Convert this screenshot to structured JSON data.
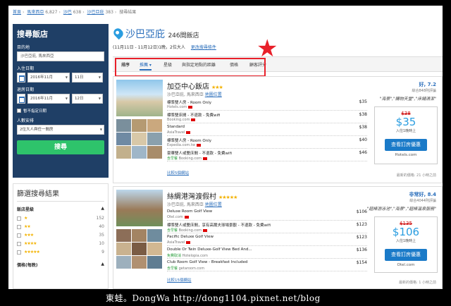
{
  "breadcrumb": {
    "items": [
      "首頁",
      "馬來西亞",
      "沙巴",
      "沙巴亞庇",
      "搜尋結果"
    ],
    "counts": [
      "6,827",
      "638",
      "383"
    ]
  },
  "search": {
    "title": "搜尋飯店",
    "dest_label": "目的地",
    "dest_value": "沙巴亞庇, 馬來西亞",
    "checkin_label": "入住日期",
    "checkin_month": "2016年11月",
    "checkin_day": "11日",
    "checkout_label": "退房日期",
    "checkout_month": "2016年11月",
    "checkout_day": "12日",
    "nodate_label": "暫不指定日期",
    "guests_label": "人數安排",
    "guests_value": "2位大人與任一間房",
    "submit": "搜尋"
  },
  "filter": {
    "title": "篩選搜尋結果",
    "section": "飯店星級",
    "rows": [
      {
        "stars": "★",
        "count": "152"
      },
      {
        "stars": "★★",
        "count": "40"
      },
      {
        "stars": "★★★",
        "count": "35"
      },
      {
        "stars": "★★★★",
        "count": "10"
      },
      {
        "stars": "★★★★★",
        "count": "9"
      }
    ],
    "price_section": "價格(每晚)"
  },
  "header": {
    "city": "沙巴亞庇",
    "count": "246間飯店",
    "dates": "(11月11日 - 11月12日)1晚，2位大人",
    "change_link": "更改搜尋條件"
  },
  "tabs": [
    "排序",
    "推薦",
    "星級",
    "與指定地點的距離",
    "價格",
    "顧客評分"
  ],
  "hotels": [
    {
      "name": "加亞中心飯店",
      "stars": "★★★",
      "location": "沙巴亞庇, 馬來西亞",
      "map_link": "地圖位置",
      "rating": "好, 7.2",
      "reviews": "綜合848則評論",
      "quote": "\"海景\",\"購物天堂\",\"床鋪清潔\"",
      "offers": [
        {
          "name": "標準雙人房 - Room Only",
          "site": "Hotels.com",
          "price": "$35"
        },
        {
          "name": "標準雙床間 - 不退款 - 免費wifi",
          "site": "Booking.com",
          "price": "$38"
        },
        {
          "name": "Standard",
          "site": "AsiaTravel",
          "price": "$38"
        },
        {
          "name": "標準雙人房 - Room Only",
          "site": "Expedia.com.tw",
          "price": "$40"
        },
        {
          "name": "豪華雙人或雙床間 - 不退款 - 免費wifi",
          "site": "Booking.com",
          "price": "$46",
          "deal": "含早餐"
        }
      ],
      "more": "比較5個網站",
      "old_price": "$38",
      "price": "$35",
      "min": "入住1晚時上",
      "deal_btn": "查看訂房優惠",
      "deal_site": "Hotels.com",
      "updated": "最新的價格: 21 小時之前"
    },
    {
      "name": "絲綢港灣渡假村",
      "stars": "★★★★★",
      "location": "沙巴亞庇, 馬來西亞",
      "map_link": "地圖位置",
      "rating": "非常好, 8.4",
      "reviews": "綜合4044則評論",
      "quote": "\"超棒游泳池\",\"海景\",\"超棒溫泉服務\"",
      "offers": [
        {
          "name": "Deluxe Room Golf View",
          "site": "Otel.com",
          "price": "$106"
        },
        {
          "name": "標準雙人或雙床間，享有高爾夫球場景觀 - 不退款 - 免費wifi",
          "site": "Booking.com",
          "price": "$123",
          "deal": "含早餐"
        },
        {
          "name": "Pacific Deluxe Golf View",
          "site": "AsiaTravel",
          "price": "$123"
        },
        {
          "name": "Double Or Twin Deluxe-Golf View Bed And...",
          "site": "Hotelopia.com",
          "price": "$136",
          "deal": "免費取消"
        },
        {
          "name": "Club Room Golf View - Breakfast Included",
          "site": "getaroom.com",
          "price": "$154",
          "deal": "含早餐"
        }
      ],
      "more": "比較15個網站",
      "old_price": "$135",
      "price": "$106",
      "min": "入住1晚時上",
      "deal_btn": "查看訂房優惠",
      "deal_site": "Otel.com",
      "updated": "最新的價格: 1 小時之前"
    }
  ],
  "watermark": "東蛙。DongWa http://dong1104.pixnet.net/blog",
  "colors": {
    "accent": "#2a6ebb",
    "nav": "#1f3f66",
    "search_btn": "#2ec36b",
    "highlight": "#e8202a"
  }
}
